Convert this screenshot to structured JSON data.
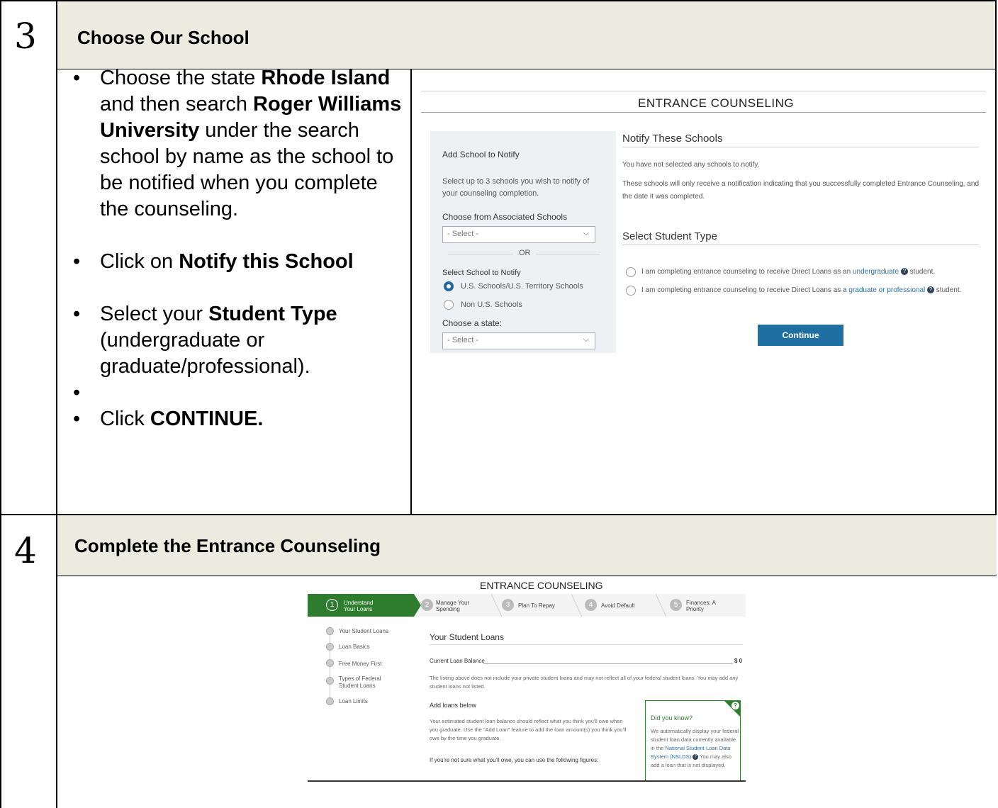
{
  "step3": {
    "number": "3",
    "title": "Choose Our School",
    "instructions": [
      {
        "parts": [
          {
            "t": "Choose the state "
          },
          {
            "b": "Rhode Island"
          },
          {
            "t": " and then search "
          },
          {
            "b": "Roger Williams University"
          },
          {
            "t": " under the search school by name as the school to be notified when you complete the counseling."
          }
        ]
      },
      {
        "parts": [
          {
            "t": "Click on "
          },
          {
            "b": "Notify this School"
          }
        ]
      },
      {
        "parts": [
          {
            "t": "Select your "
          },
          {
            "b": "Student Type"
          },
          {
            "t": " (undergraduate or graduate/professional)."
          }
        ]
      },
      {
        "parts": []
      },
      {
        "parts": [
          {
            "t": "Click "
          },
          {
            "b": "CONTINUE."
          }
        ]
      }
    ],
    "screenshot": {
      "title": "ENTRANCE COUNSELING",
      "add_school_heading": "Add School to Notify",
      "add_school_desc": "Select up to 3 schools you wish to notify of your counseling completion.",
      "associated_label": "Choose from Associated Schools",
      "select_placeholder": "- Select -",
      "or_text": "OR",
      "select_school_label": "Select School to Notify",
      "radio_us": "U.S. Schools/U.S. Territory Schools",
      "radio_non_us": "Non U.S. Schools",
      "state_label": "Choose a state:",
      "notify_heading": "Notify These Schools",
      "notify_none": "You have not selected any schools to notify.",
      "notify_desc": "These schools will only receive a notification indicating that you successfully completed Entrance Counseling, and the date it was completed.",
      "student_type_heading": "Select Student Type",
      "option_ug_pre": "I am completing entrance counseling to receive Direct Loans as an ",
      "option_ug_link": "undergraduate",
      "option_ug_post": " student.",
      "option_grad_pre": "I am completing entrance counseling to receive Direct Loans as a ",
      "option_grad_link": "graduate or professional",
      "option_grad_post": " student.",
      "continue_label": "Continue"
    }
  },
  "step4": {
    "number": "4",
    "title": "Complete the Entrance Counseling",
    "screenshot": {
      "title": "ENTRANCE COUNSELING",
      "steps": [
        {
          "num": "1",
          "label": "Understand Your Loans"
        },
        {
          "num": "2",
          "label": "Manage Your Spending"
        },
        {
          "num": "3",
          "label": "Plan To Repay"
        },
        {
          "num": "4",
          "label": "Avoid Default"
        },
        {
          "num": "5",
          "label": "Finances: A Priority"
        }
      ],
      "nav": [
        "Your Student Loans",
        "Loan Basics",
        "Free Money First",
        "Types of Federal Student Loans",
        "Loan Limits"
      ],
      "heading": "Your Student Loans",
      "balance_label": "Current Loan Balance",
      "balance_value": "$ 0",
      "listing_note": "The listing above does not include your private student loans and may not reflect all of your federal student loans. You may add any student loans not listed.",
      "add_loans_heading": "Add loans below",
      "add_loans_desc": "Your estimated student loan balance should reflect what you think you'll owe when you graduate. Use the \"Add Loan\" feature to add the loan amount(s) you think you'll owe by the time you graduate.",
      "figures_note": "If you're not sure what you'll owe, you can use the following figures:",
      "did_you_know": "Did you know?",
      "dyk_pre": "We automatically display your federal student loan data currently available in the ",
      "dyk_link": "National Student Loan Data System (NSLDS)",
      "dyk_post": " You may also add a loan that is not displayed."
    }
  }
}
